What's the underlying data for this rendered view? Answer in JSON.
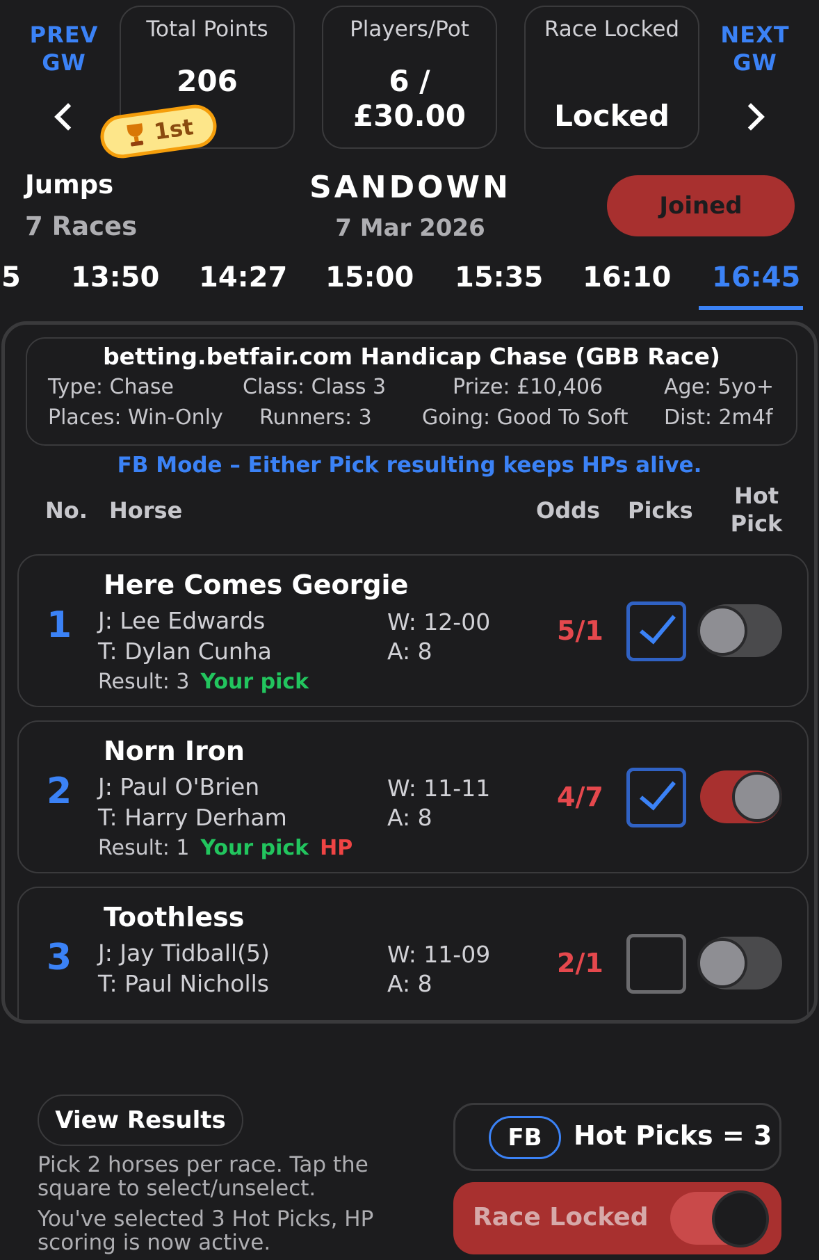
{
  "nav": {
    "prev_label": "PREV\nGW",
    "next_label": "NEXT\nGW"
  },
  "stats": {
    "total_points_label": "Total Points",
    "total_points_value": "206",
    "players_pot_label": "Players/Pot",
    "players_pot_value": "6 /\n£30.00",
    "race_locked_label": "Race Locked",
    "race_locked_value": "Locked"
  },
  "rank_badge": "1st",
  "meeting": {
    "type": "Jumps",
    "races": "7 Races",
    "course": "SANDOWN",
    "date": "7 Mar 2026",
    "joined_label": "Joined"
  },
  "race_times": [
    "5",
    "13:50",
    "14:27",
    "15:00",
    "15:35",
    "16:10",
    "16:45"
  ],
  "active_time": "16:45",
  "race": {
    "title": "betting.betfair.com Handicap Chase (GBB Race)",
    "type": "Type: Chase",
    "class": "Class: Class 3",
    "prize": "Prize: £10,406",
    "age": "Age: 5yo+",
    "places": "Places: Win-Only",
    "runners": "Runners: 3",
    "going": "Going: Good To Soft",
    "dist": "Dist: 2m4f"
  },
  "fb_note": "FB Mode – Either Pick resulting keeps HPs alive.",
  "columns": {
    "no": "No.",
    "horse": "Horse",
    "odds": "Odds",
    "picks": "Picks",
    "hot_pick": "Hot\nPick"
  },
  "horses": [
    {
      "no": "1",
      "name": "Here Comes Georgie",
      "jockey": "J: Lee Edwards",
      "trainer": "T: Dylan Cunha",
      "weight": "W: 12-00",
      "age": "A: 8",
      "result": "Result: 3",
      "pick_label": "Your pick",
      "hp_label": "",
      "odds": "5/1",
      "picked": true,
      "hot_pick": false
    },
    {
      "no": "2",
      "name": "Norn Iron",
      "jockey": "J: Paul O'Brien",
      "trainer": "T: Harry Derham",
      "weight": "W: 11-11",
      "age": "A: 8",
      "result": "Result: 1",
      "pick_label": "Your pick",
      "hp_label": "HP",
      "odds": "4/7",
      "picked": true,
      "hot_pick": true
    },
    {
      "no": "3",
      "name": "Toothless",
      "jockey": "J: Jay Tidball(5)",
      "trainer": "T: Paul Nicholls",
      "weight": "W: 11-09",
      "age": "A: 8",
      "odds": "2/1",
      "picked": false,
      "hot_pick": false
    }
  ],
  "footer": {
    "view_results": "View Results",
    "help_1": "Pick 2 horses per race. Tap the square to select/unselect.",
    "help_2": "You've selected 3 Hot Picks, HP scoring is now active.",
    "fb_label": "FB",
    "hot_picks": "Hot Picks = 3",
    "race_locked_button": "Race Locked"
  },
  "colors": {
    "background": "#1c1c1e",
    "accent_blue": "#3b82f6",
    "red": "#a8302f",
    "odds_red": "#e5484d",
    "pick_green": "#22c55e"
  }
}
